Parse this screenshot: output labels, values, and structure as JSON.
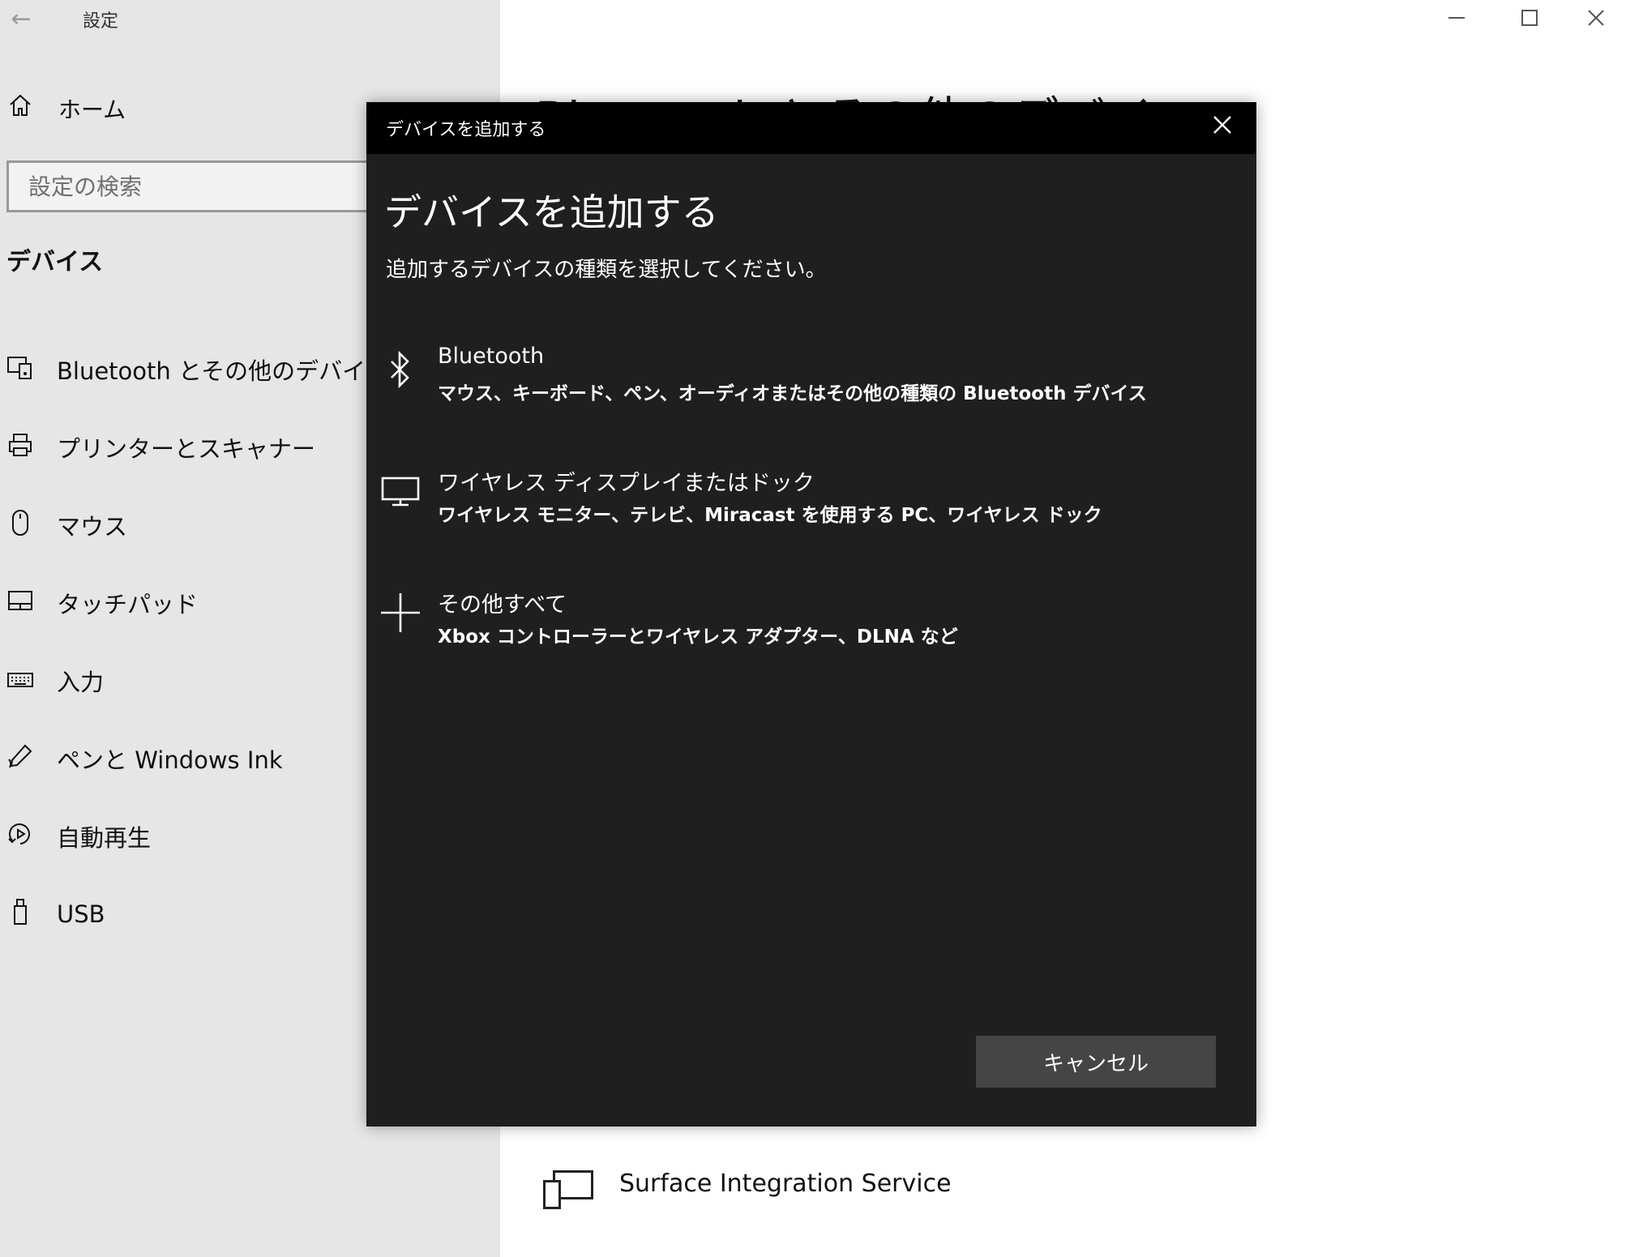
{
  "app": {
    "title": "設定",
    "back_label": "←"
  },
  "sidebar": {
    "home_label": "ホーム",
    "search_placeholder": "設定の検索",
    "section_title": "デバイス",
    "items": [
      {
        "label": "Bluetooth とその他のデバイス",
        "icon": "bluetooth-devices-icon"
      },
      {
        "label": "プリンターとスキャナー",
        "icon": "printer-icon"
      },
      {
        "label": "マウス",
        "icon": "mouse-icon"
      },
      {
        "label": "タッチパッド",
        "icon": "touchpad-icon"
      },
      {
        "label": "入力",
        "icon": "keyboard-icon"
      },
      {
        "label": "ペンと Windows Ink",
        "icon": "pen-icon"
      },
      {
        "label": "自動再生",
        "icon": "autoplay-icon"
      },
      {
        "label": "USB",
        "icon": "usb-icon"
      }
    ]
  },
  "main": {
    "page_heading": "Bluetooth とその他のデバイス",
    "device_name": "Surface Integration Service"
  },
  "dialog": {
    "titlebar": "デバイスを追加する",
    "heading": "デバイスを追加する",
    "subtitle": "追加するデバイスの種類を選択してください。",
    "options": [
      {
        "title": "Bluetooth",
        "desc": "マウス、キーボード、ペン、オーディオまたはその他の種類の Bluetooth デバイス",
        "icon": "bluetooth-icon"
      },
      {
        "title": "ワイヤレス ディスプレイまたはドック",
        "desc": "ワイヤレス モニター、テレビ、Miracast を使用する PC、ワイヤレス ドック",
        "icon": "monitor-icon"
      },
      {
        "title": "その他すべて",
        "desc": "Xbox コントローラーとワイヤレス アダプター、DLNA など",
        "icon": "plus-icon"
      }
    ],
    "cancel_label": "キャンセル"
  },
  "colors": {
    "sidebar_bg": "#e6e6e6",
    "dialog_bg": "#1f1f1f",
    "dialog_titlebar_bg": "#000000",
    "cancel_bg": "#454545"
  }
}
